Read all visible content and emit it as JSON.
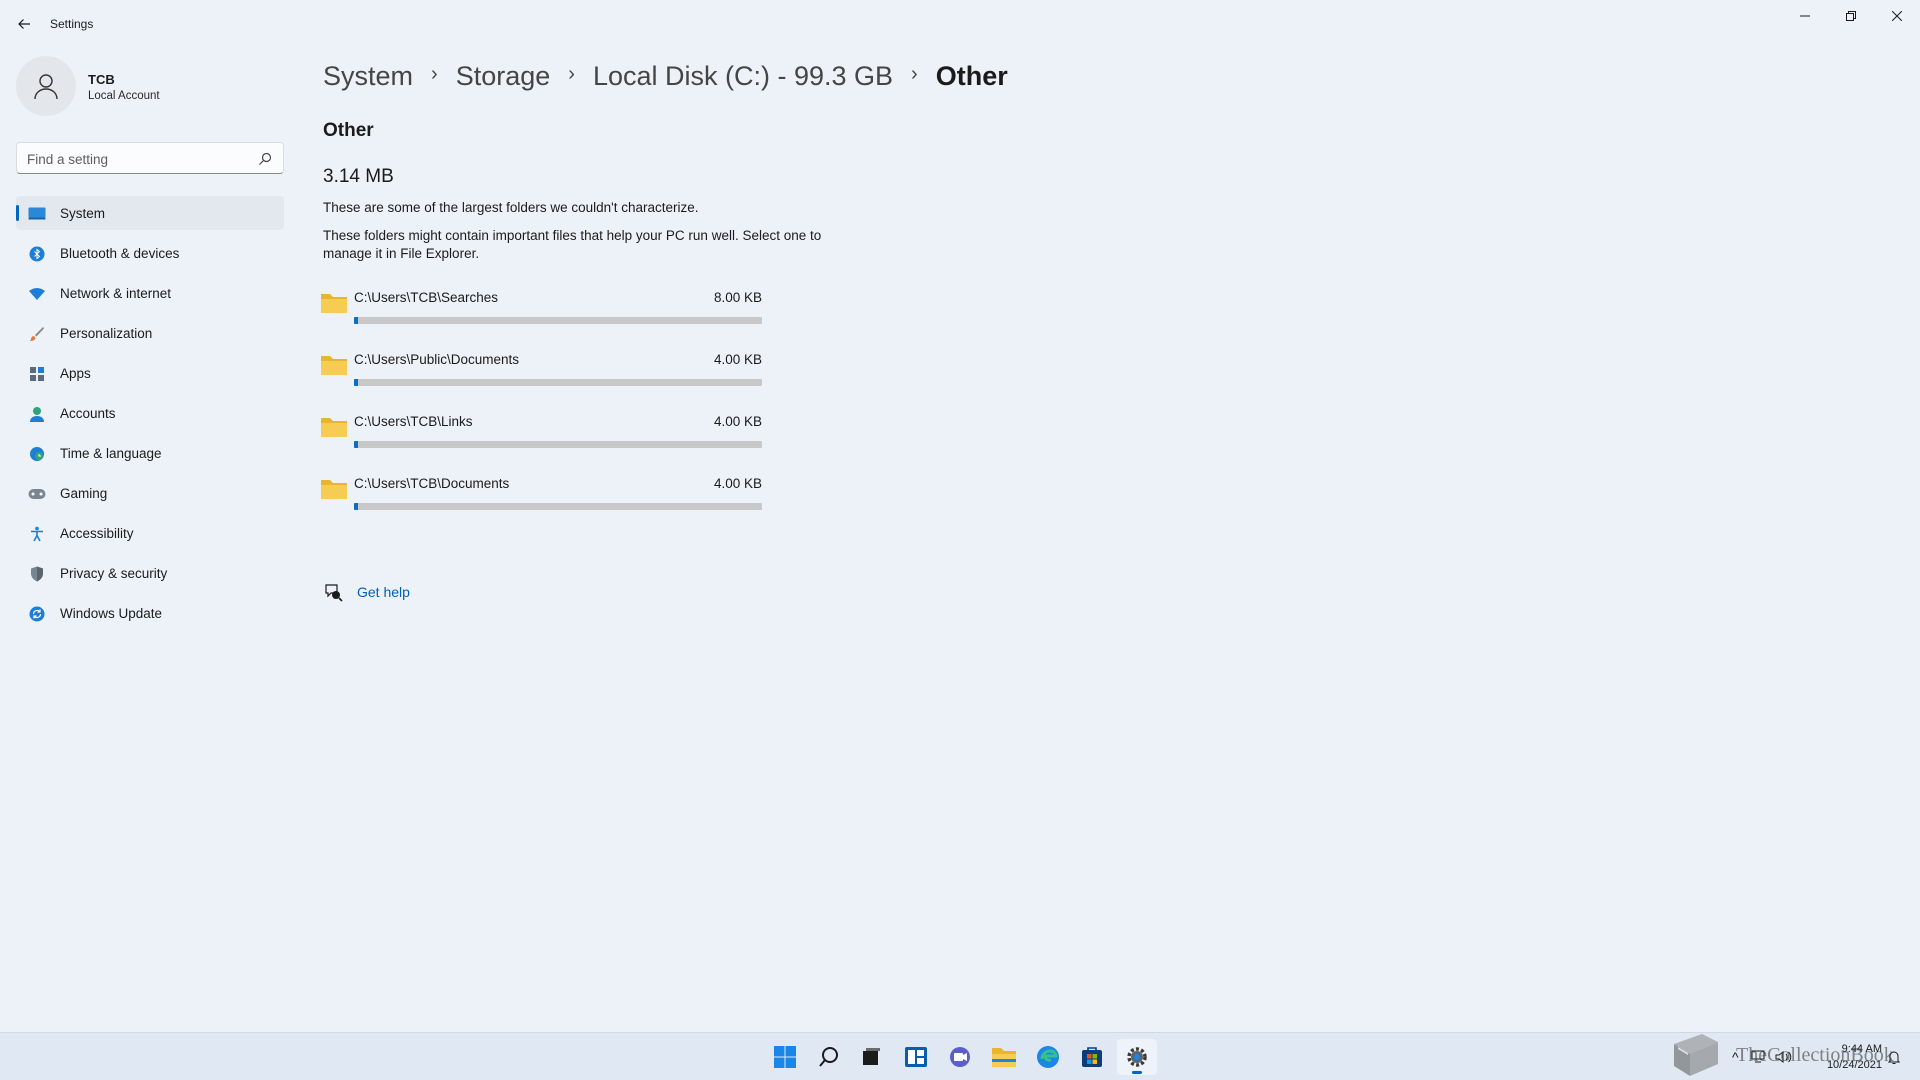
{
  "window": {
    "title": "Settings"
  },
  "profile": {
    "name": "TCB",
    "account_type": "Local Account"
  },
  "search": {
    "placeholder": "Find a setting",
    "value": ""
  },
  "sidebar": {
    "items": [
      {
        "label": "System",
        "icon": "system-icon",
        "active": true
      },
      {
        "label": "Bluetooth & devices",
        "icon": "bluetooth-icon",
        "active": false
      },
      {
        "label": "Network & internet",
        "icon": "wifi-icon",
        "active": false
      },
      {
        "label": "Personalization",
        "icon": "brush-icon",
        "active": false
      },
      {
        "label": "Apps",
        "icon": "apps-icon",
        "active": false
      },
      {
        "label": "Accounts",
        "icon": "accounts-icon",
        "active": false
      },
      {
        "label": "Time & language",
        "icon": "globe-clock-icon",
        "active": false
      },
      {
        "label": "Gaming",
        "icon": "gamepad-icon",
        "active": false
      },
      {
        "label": "Accessibility",
        "icon": "accessibility-icon",
        "active": false
      },
      {
        "label": "Privacy & security",
        "icon": "shield-icon",
        "active": false
      },
      {
        "label": "Windows Update",
        "icon": "update-icon",
        "active": false
      }
    ]
  },
  "breadcrumb": {
    "items": [
      "System",
      "Storage",
      "Local Disk (C:) - 99.3 GB",
      "Other"
    ]
  },
  "main": {
    "section_title": "Other",
    "total_size": "3.14 MB",
    "description_1": "These are some of the largest folders we couldn't characterize.",
    "description_2": "These folders might contain important files that help your PC run well. Select one to manage it in File Explorer.",
    "folders": [
      {
        "path": "C:\\Users\\TCB\\Searches",
        "size": "8.00 KB",
        "usage_fraction": 0.01
      },
      {
        "path": "C:\\Users\\Public\\Documents",
        "size": "4.00 KB",
        "usage_fraction": 0.01
      },
      {
        "path": "C:\\Users\\TCB\\Links",
        "size": "4.00 KB",
        "usage_fraction": 0.01
      },
      {
        "path": "C:\\Users\\TCB\\Documents",
        "size": "4.00 KB",
        "usage_fraction": 0.01
      }
    ],
    "help_label": "Get help"
  },
  "taskbar": {
    "apps": [
      "start-icon",
      "search-icon",
      "task-view-icon",
      "widgets-icon",
      "chat-icon",
      "file-explorer-icon",
      "edge-icon",
      "store-icon",
      "settings-icon"
    ],
    "active_app": "settings-icon",
    "time": "9:44 AM",
    "date": "10/24/2021"
  },
  "watermark": {
    "text": "TheCollectionBook"
  },
  "colors": {
    "accent": "#0067c0",
    "bar_fill": "#0a6fc4",
    "bar_track": "#c8c8c8",
    "folder_yellow": "#f5c542",
    "link": "#005fb8"
  }
}
